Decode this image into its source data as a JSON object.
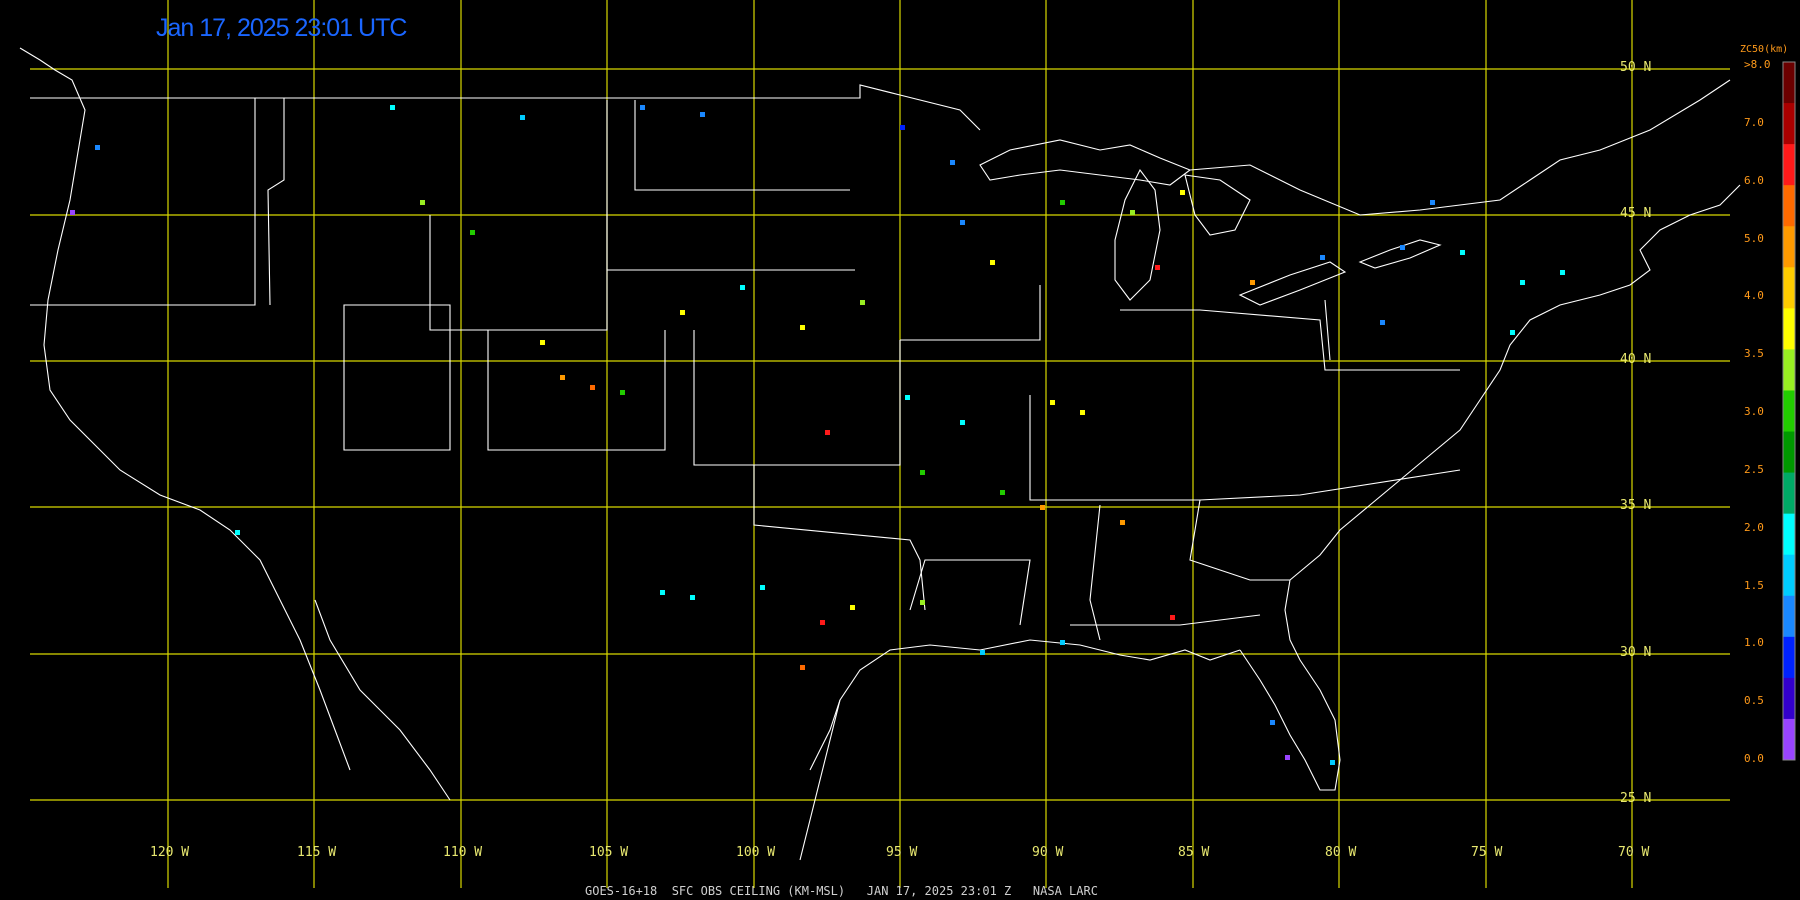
{
  "timestamp": "Jan 17, 2025 23:01 UTC",
  "footer": "GOES-16+18  SFC OBS CEILING (KM-MSL)   JAN 17, 2025 23:01 Z   NASA LARC",
  "latitudes": [
    "50 N",
    "45 N",
    "40 N",
    "35 N",
    "30 N",
    "25 N"
  ],
  "longitudes": [
    "120 W",
    "115 W",
    "110 W",
    "105 W",
    "100 W",
    "95 W",
    "90 W",
    "85 W",
    "80 W",
    "75 W",
    "70 W"
  ],
  "legend": {
    "title": "ZC50(km)",
    "ticks": [
      ">8.0",
      "7.0",
      "6.0",
      "5.0",
      "4.0",
      "3.5",
      "3.0",
      "2.5",
      "2.0",
      "1.5",
      "1.0",
      "0.5",
      "0.0"
    ],
    "colors": [
      "#6b0000",
      "#aa0000",
      "#ff1a1a",
      "#ff6a00",
      "#ff9a00",
      "#ffcc00",
      "#ffff00",
      "#99ee22",
      "#22cc00",
      "#009900",
      "#00aa66",
      "#00ffff",
      "#00ccff",
      "#1a88ff",
      "#0022ff",
      "#3300cc",
      "#9944ff"
    ]
  },
  "map_colors": {
    "grid": "#d8d800",
    "borders": "#ffffff",
    "background": "#000000"
  }
}
